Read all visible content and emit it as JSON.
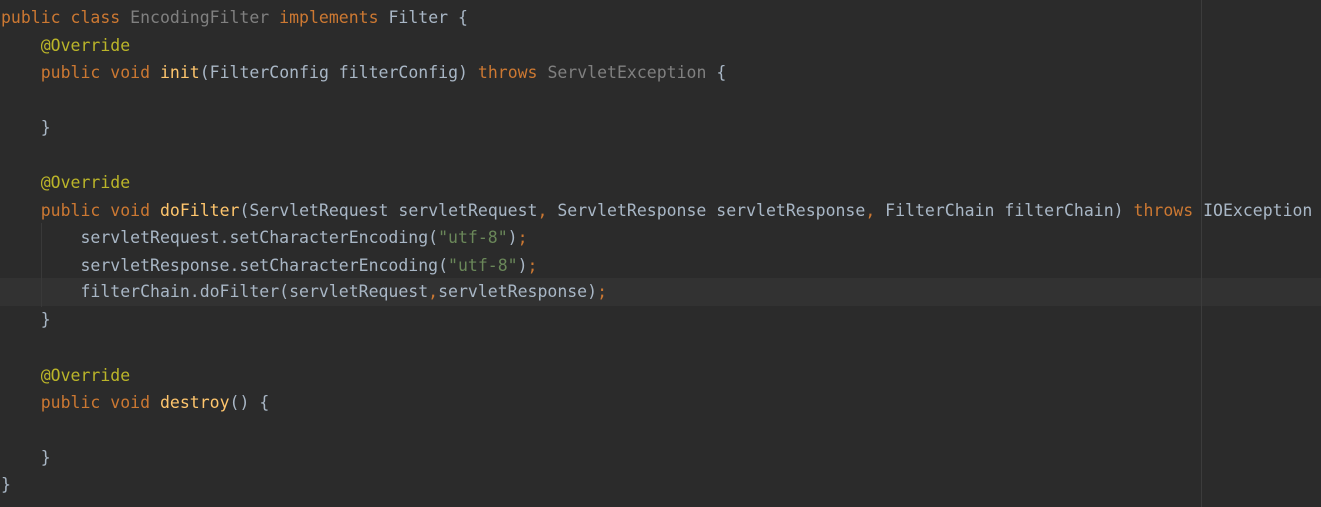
{
  "code": {
    "l1": {
      "kw_public": "public",
      "kw_class": "class",
      "class_name": "EncodingFilter",
      "kw_implements": "implements",
      "iface": "Filter",
      "brace": "{"
    },
    "l2": {
      "annotation": "@Override"
    },
    "l3": {
      "kw_public": "public",
      "kw_void": "void",
      "method": "init",
      "params": "(FilterConfig filterConfig)",
      "kw_throws": "throws",
      "exception": "ServletException",
      "brace": "{"
    },
    "l5": {
      "brace": "}"
    },
    "l7": {
      "annotation": "@Override"
    },
    "l8": {
      "kw_public": "public",
      "kw_void": "void",
      "method": "doFilter",
      "param_1": "(ServletRequest servletRequest",
      "comma_1": ",",
      "param_2": " ServletResponse servletResponse",
      "comma_2": ",",
      "param_3": " FilterChain filterChain)",
      "kw_throws": "throws",
      "exception": "IOException"
    },
    "l9": {
      "call": "servletRequest.setCharacterEncoding(",
      "string": "\"utf-8\"",
      "close": ")",
      "semicolon": ";"
    },
    "l10": {
      "call": "servletResponse.setCharacterEncoding(",
      "string": "\"utf-8\"",
      "close": ")",
      "semicolon": ";"
    },
    "l11": {
      "call": "filterChain.doFilter(servletRequest",
      "comma": ",",
      "args_rest": "servletResponse)",
      "semicolon": ";"
    },
    "l12": {
      "brace": "}"
    },
    "l14": {
      "annotation": "@Override"
    },
    "l15": {
      "kw_public": "public",
      "kw_void": "void",
      "method": "destroy",
      "params": "()",
      "brace": "{"
    },
    "l17": {
      "brace": "}"
    },
    "l18": {
      "brace": "}"
    }
  },
  "colors": {
    "background": "#2b2b2b",
    "keyword": "#cc7832",
    "annotation": "#bbb529",
    "method_declaration": "#ffc66d",
    "string": "#6a8759",
    "default_text": "#a9b7c6",
    "unused_class": "#808080",
    "caret_row": "#323232"
  }
}
